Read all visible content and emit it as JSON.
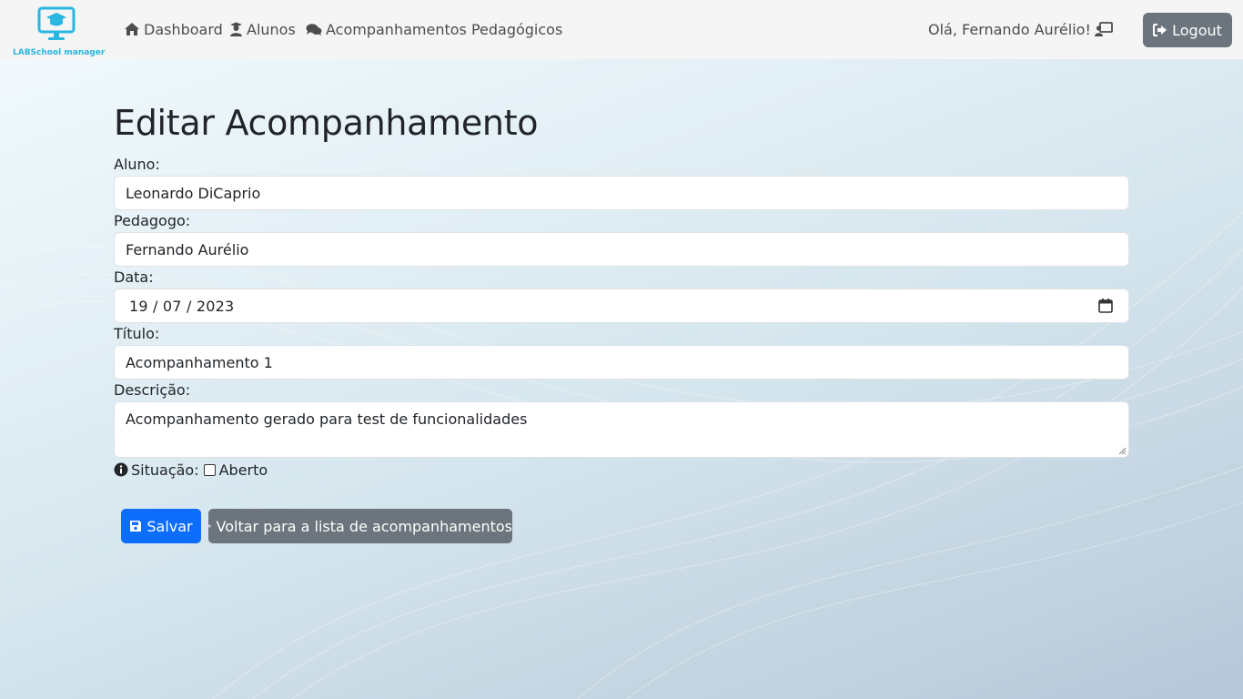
{
  "brand": {
    "name": "LABSchool manager"
  },
  "nav": {
    "dashboard": "Dashboard",
    "alunos": "Alunos",
    "acompanhamentos": "Acompanhamentos Pedagógicos"
  },
  "user": {
    "greeting": "Olá, Fernando Aurélio!",
    "logout_label": "Logout"
  },
  "form": {
    "title": "Editar Acompanhamento",
    "aluno_label": "Aluno:",
    "aluno_value": "Leonardo DiCaprio",
    "pedagogo_label": "Pedagogo:",
    "pedagogo_value": "Fernando Aurélio",
    "data_label": "Data:",
    "data_value": "19 / 07 / 2023",
    "titulo_label": "Título:",
    "titulo_value": "Acompanhamento 1",
    "descricao_label": "Descrição:",
    "descricao_value": "Acompanhamento gerado para test de funcionalidades",
    "situacao_label": "Situação:",
    "situacao_option": "Aberto",
    "situacao_checked": false
  },
  "actions": {
    "save_label": "Salvar",
    "back_label": "Voltar para a lista de acompanhamentos"
  },
  "colors": {
    "primary": "#0d6efd",
    "secondary": "#6c757d",
    "brand": "#29b6e0",
    "navbar_bg": "#f5f5f5"
  },
  "icons": {
    "brand": "laptop-graduation-cap-icon",
    "dashboard": "house-icon",
    "alunos": "user-graduate-icon",
    "acompanhamentos": "comments-icon",
    "greeting": "chalkboard-user-icon",
    "logout": "sign-out-icon",
    "calendar": "calendar-icon",
    "situacao": "info-circle-icon",
    "save": "floppy-disk-icon",
    "back": "arrow-left-icon"
  }
}
